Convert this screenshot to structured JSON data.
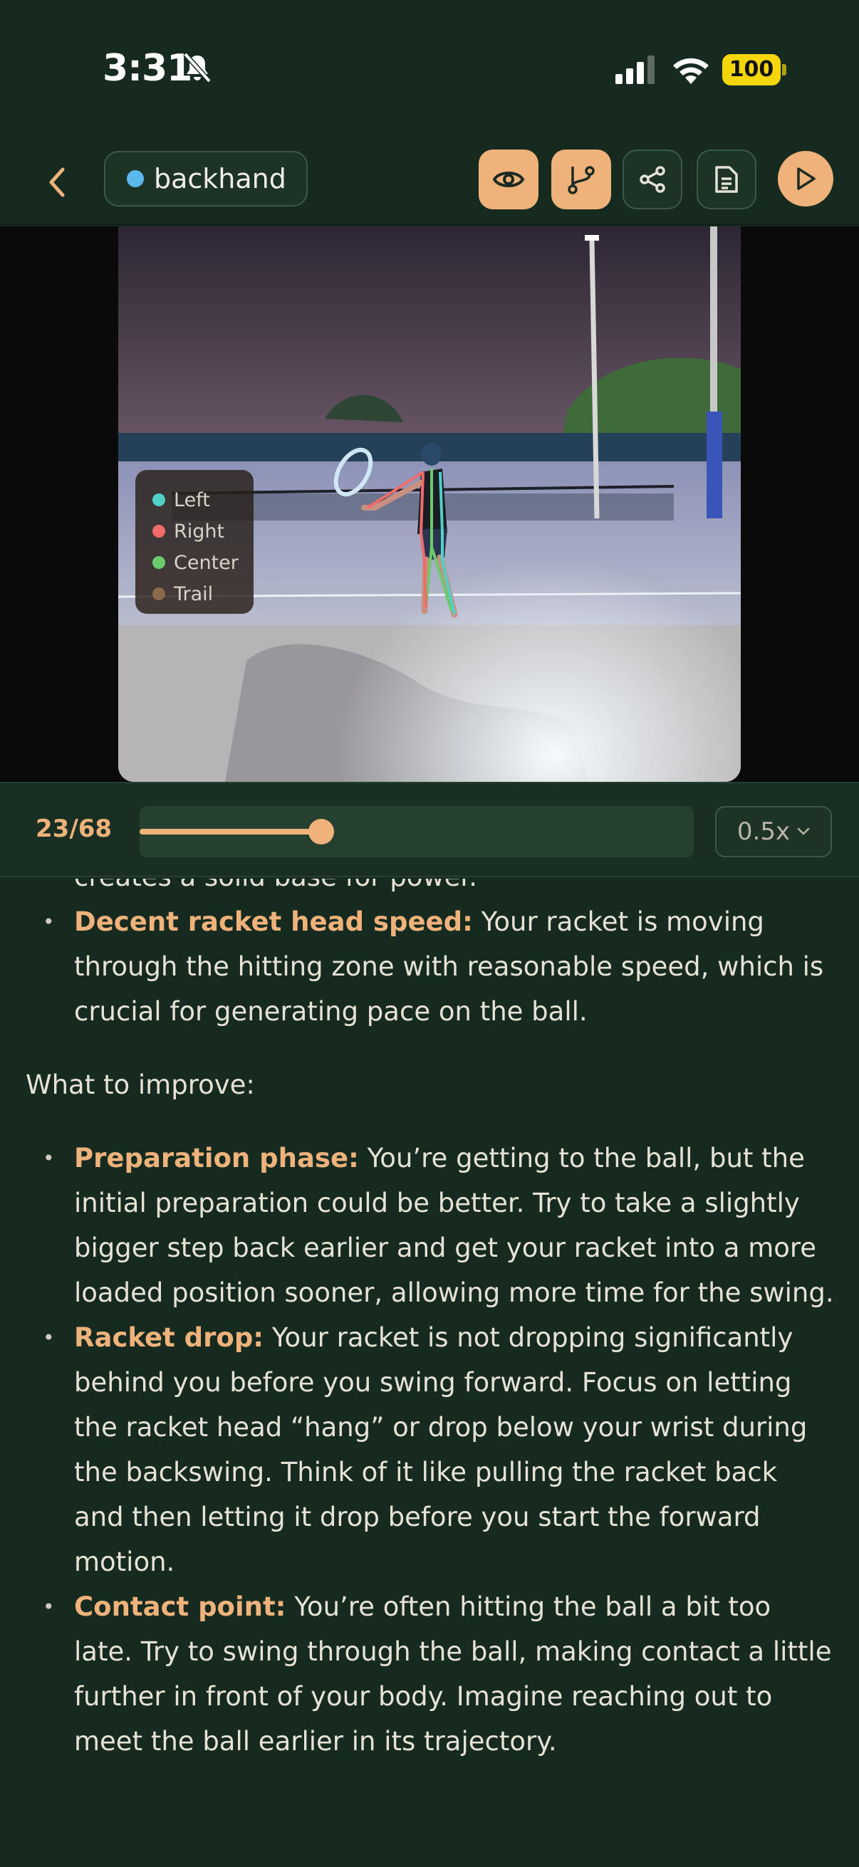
{
  "status": {
    "time": "3:31",
    "battery": "100"
  },
  "toolbar": {
    "tag_label": "backhand",
    "tag_color": "#5ab8ea",
    "buttons": [
      "back-chevron-icon",
      "eye-icon",
      "branch-icon",
      "share-icon",
      "document-icon",
      "play-icon"
    ],
    "accent": "#eeb27a"
  },
  "legend": [
    {
      "label": "Left",
      "color": "#4fd1c5"
    },
    {
      "label": "Right",
      "color": "#f26b6b"
    },
    {
      "label": "Center",
      "color": "#6cc96c"
    },
    {
      "label": "Trail",
      "color": "#8b6a4b"
    }
  ],
  "scrubber": {
    "frame_label": "23/68",
    "progress": 0.328,
    "speed": "0.5x"
  },
  "content": {
    "partial_line": "creates a solid base for power.",
    "strengths": [
      {
        "title": "Decent racket head speed:",
        "text": " Your racket is moving through the hitting zone with reasonable speed, which is crucial for generating pace on the ball."
      }
    ],
    "improve_heading": "What to improve:",
    "improvements": [
      {
        "title": "Preparation phase:",
        "text": " You’re getting to the ball, but the initial preparation could be better. Try to take a slightly bigger step back earlier and get your racket into a more loaded position sooner, allowing more time for the swing."
      },
      {
        "title": "Racket drop:",
        "text": " Your racket is not dropping significantly behind you before you swing forward. Focus on letting the racket head “hang” or drop below your wrist during the backswing. Think of it like pulling the racket back and then letting it drop before you start the forward motion."
      },
      {
        "title": "Contact point:",
        "text": " You’re often hitting the ball a bit too late. Try to swing through the ball, making contact a little further in front of your body. Imagine reaching out to meet the ball earlier in its trajectory."
      }
    ]
  }
}
